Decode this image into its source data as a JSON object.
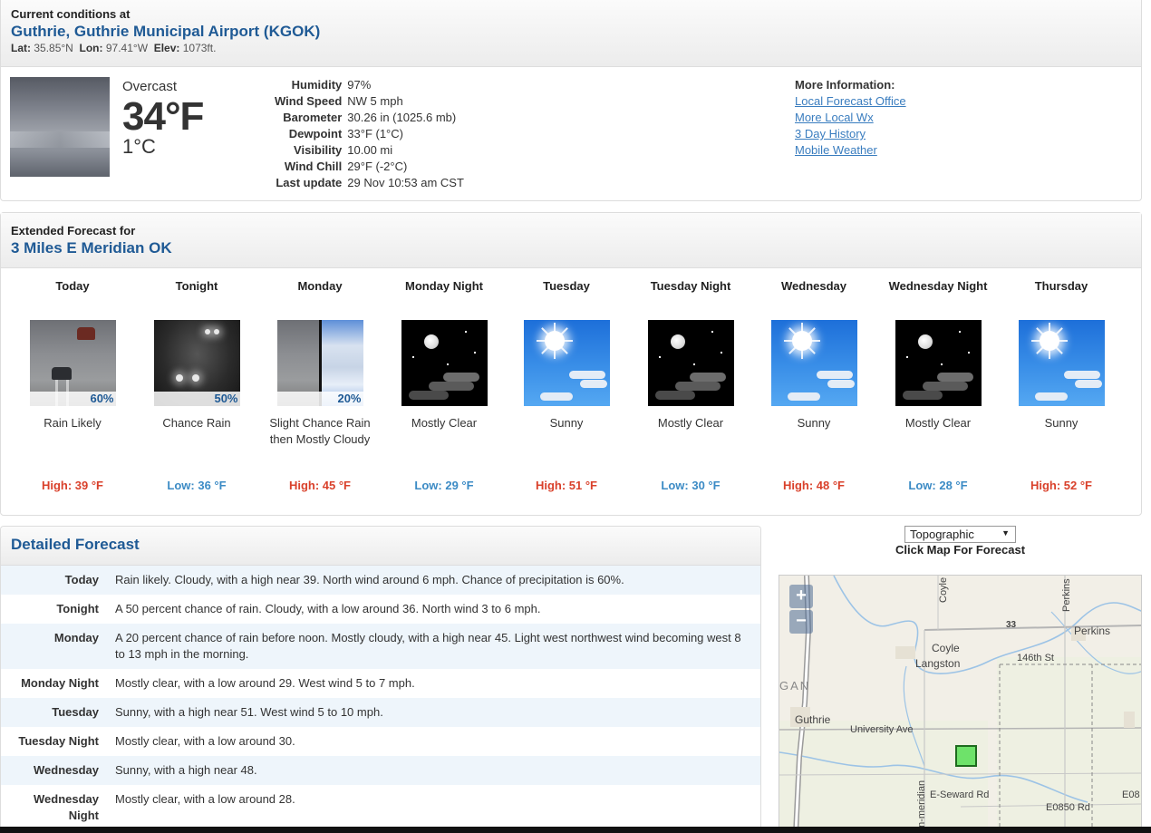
{
  "current": {
    "heading": "Current conditions at",
    "station": "Guthrie, Guthrie Municipal Airport (KGOK)",
    "lat_label": "Lat:",
    "lat": "35.85°N",
    "lon_label": "Lon:",
    "lon": "97.41°W",
    "elev_label": "Elev:",
    "elev": "1073ft.",
    "summary": "Overcast",
    "temp_f": "34°F",
    "temp_c": "1°C",
    "details": [
      {
        "label": "Humidity",
        "value": "97%"
      },
      {
        "label": "Wind Speed",
        "value": "NW 5 mph"
      },
      {
        "label": "Barometer",
        "value": "30.26 in (1025.6 mb)"
      },
      {
        "label": "Dewpoint",
        "value": "33°F (1°C)"
      },
      {
        "label": "Visibility",
        "value": "10.00 mi"
      },
      {
        "label": "Wind Chill",
        "value": "29°F (-2°C)"
      },
      {
        "label": "Last update",
        "value": "29 Nov 10:53 am CST"
      }
    ],
    "more_info": {
      "heading": "More Information:",
      "links": [
        "Local Forecast Office",
        "More Local Wx",
        "3 Day History",
        "Mobile Weather"
      ]
    }
  },
  "extended": {
    "heading": "Extended Forecast for",
    "location": "3 Miles E Meridian OK",
    "periods": [
      {
        "name": "Today",
        "icon": "rain-icon",
        "pop": "60%",
        "short": "Rain Likely",
        "temp": "High: 39 °F",
        "kind": "high"
      },
      {
        "name": "Tonight",
        "icon": "night-rain-icon",
        "pop": "50%",
        "short": "Chance Rain",
        "temp": "Low: 36 °F",
        "kind": "low"
      },
      {
        "name": "Monday",
        "icon": "rain-then-cloudy-icon",
        "pop": "20%",
        "short": "Slight Chance Rain then Mostly Cloudy",
        "temp": "High: 45 °F",
        "kind": "high"
      },
      {
        "name": "Monday Night",
        "icon": "night-clear-icon",
        "pop": "",
        "short": "Mostly Clear",
        "temp": "Low: 29 °F",
        "kind": "low"
      },
      {
        "name": "Tuesday",
        "icon": "sunny-icon",
        "pop": "",
        "short": "Sunny",
        "temp": "High: 51 °F",
        "kind": "high"
      },
      {
        "name": "Tuesday Night",
        "icon": "night-clear-icon",
        "pop": "",
        "short": "Mostly Clear",
        "temp": "Low: 30 °F",
        "kind": "low"
      },
      {
        "name": "Wednesday",
        "icon": "sunny-icon",
        "pop": "",
        "short": "Sunny",
        "temp": "High: 48 °F",
        "kind": "high"
      },
      {
        "name": "Wednesday Night",
        "icon": "night-clear-icon",
        "pop": "",
        "short": "Mostly Clear",
        "temp": "Low: 28 °F",
        "kind": "low"
      },
      {
        "name": "Thursday",
        "icon": "sunny-icon",
        "pop": "",
        "short": "Sunny",
        "temp": "High: 52 °F",
        "kind": "high"
      }
    ]
  },
  "detailed": {
    "title": "Detailed Forecast",
    "rows": [
      {
        "name": "Today",
        "text": "Rain likely. Cloudy, with a high near 39. North wind around 6 mph. Chance of precipitation is 60%."
      },
      {
        "name": "Tonight",
        "text": "A 50 percent chance of rain. Cloudy, with a low around 36. North wind 3 to 6 mph."
      },
      {
        "name": "Monday",
        "text": "A 20 percent chance of rain before noon. Mostly cloudy, with a high near 45. Light west northwest wind becoming west 8 to 13 mph in the morning."
      },
      {
        "name": "Monday Night",
        "text": "Mostly clear, with a low around 29. West wind 5 to 7 mph."
      },
      {
        "name": "Tuesday",
        "text": "Sunny, with a high near 51. West wind 5 to 10 mph."
      },
      {
        "name": "Tuesday Night",
        "text": "Mostly clear, with a low around 30."
      },
      {
        "name": "Wednesday",
        "text": "Sunny, with a high near 48."
      },
      {
        "name": "Wednesday Night",
        "text": "Mostly clear, with a low around 28."
      }
    ]
  },
  "map": {
    "layer_selected": "Topographic",
    "hint": "Click Map For Forecast",
    "zoom_in": "+",
    "zoom_out": "−",
    "labels": [
      "Coyle",
      "Perkins",
      "Coyle",
      "Langston",
      "146th St",
      "GAN",
      "Guthrie",
      "University Ave",
      "E-Seward Rd",
      "E0850 Rd",
      "E08",
      "an-meridian",
      "33"
    ]
  },
  "colors": {
    "title_blue": "#1f5a95",
    "link_blue": "#3a7dbf",
    "high_red": "#d9412b",
    "low_blue": "#3c8bc5"
  }
}
